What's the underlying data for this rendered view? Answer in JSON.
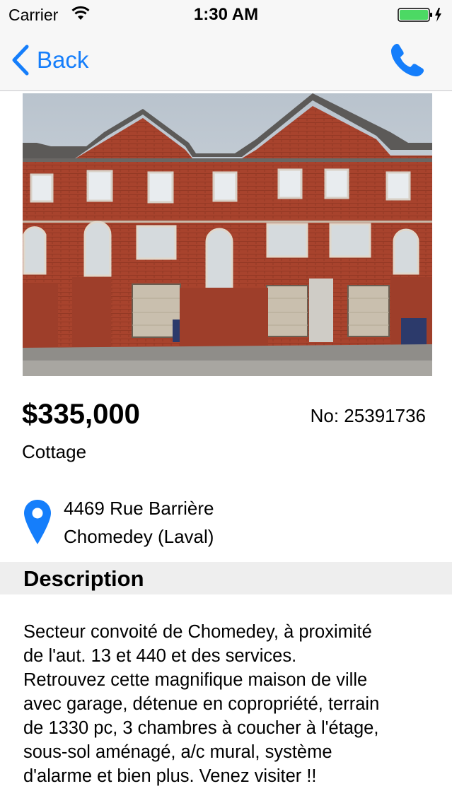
{
  "status_bar": {
    "carrier": "Carrier",
    "time": "1:30 AM",
    "battery_color": "#4cd964"
  },
  "nav": {
    "back_label": "Back",
    "accent_color": "#157efb",
    "right_icon": "phone-icon"
  },
  "listing": {
    "photo_icon": "house-photo",
    "price": "$335,000",
    "number": "No: 25391736",
    "type": "Cottage",
    "address_line1": "4469 Rue Barrière",
    "address_line2": "Chomedey (Laval)"
  },
  "description": {
    "title": "Description",
    "lines": [
      "Secteur convoité de Chomedey, à proximité",
      "de l'aut. 13 et 440 et des services.",
      "Retrouvez cette magnifique maison de ville",
      "avec garage, détenue en copropriété, terrain",
      "de 1330 pc, 3 chambres à coucher à l'étage,",
      "sous-sol aménagé, a/c mural, système",
      "d'alarme et bien plus. Venez visiter !!"
    ]
  }
}
